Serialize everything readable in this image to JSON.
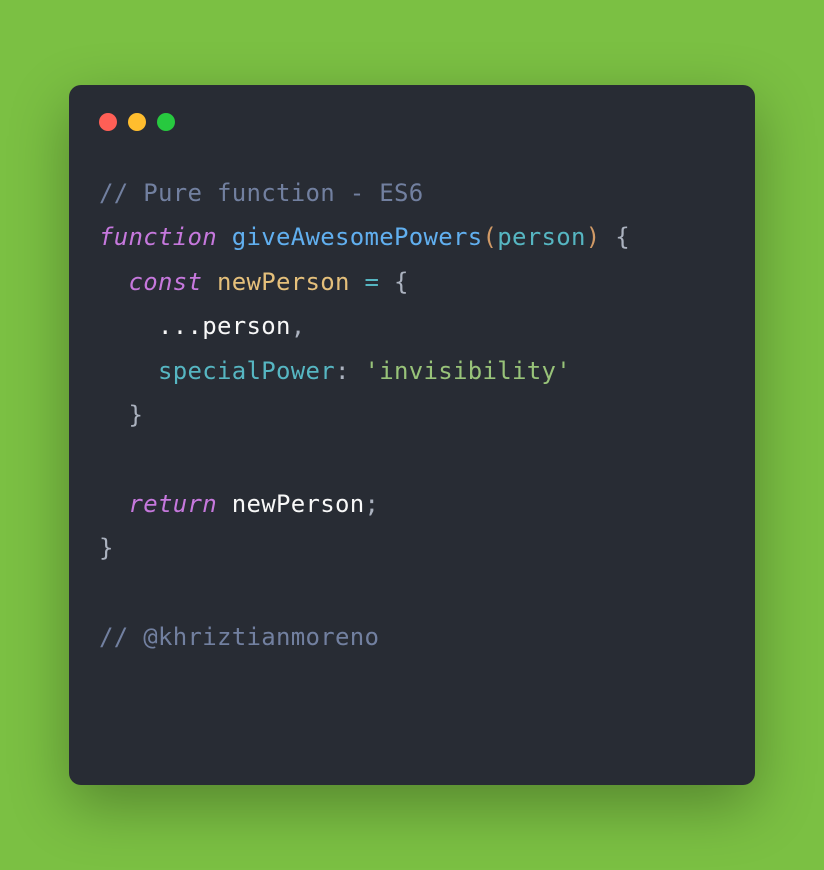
{
  "window": {
    "theme": "dark",
    "background": "#282c34"
  },
  "code": {
    "comment1": "// Pure function - ES6",
    "kw_function": "function",
    "fn_name": "giveAwesomePowers",
    "paren_open": "(",
    "param": "person",
    "paren_close": ")",
    "brace_open": " {",
    "kw_const": "const",
    "var_name": "newPerson",
    "op_assign": " = ",
    "obj_open": "{",
    "spread": "    ...",
    "spread_var": "person",
    "comma": ",",
    "prop_name": "    specialPower",
    "colon": ": ",
    "string_val": "'invisibility'",
    "obj_close": "  }",
    "kw_return": "return",
    "return_var": "newPerson",
    "semicolon": ";",
    "fn_close": "}",
    "comment2": "// @khriztianmoreno"
  }
}
